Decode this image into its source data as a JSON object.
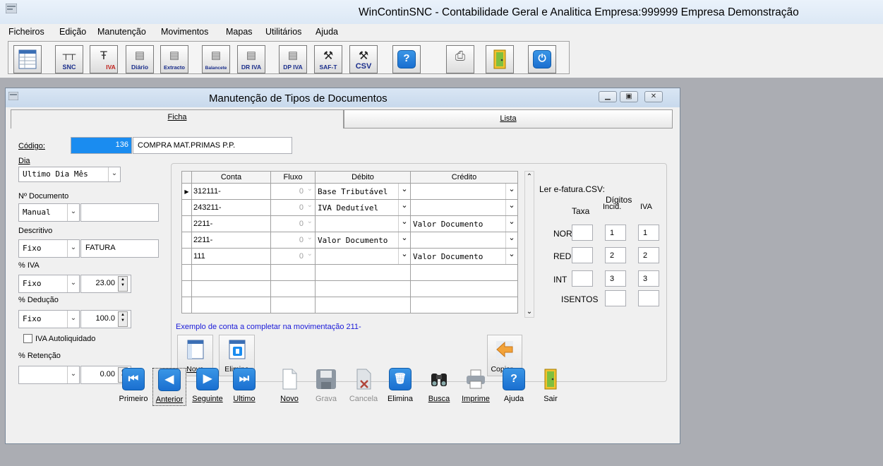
{
  "app": {
    "title": "WinContinSNC - Contabilidade Geral e Analitica Empresa:999999 Empresa Demonstração"
  },
  "menu": [
    "Ficheiros",
    "Edição",
    "Manutenção",
    "Movimentos",
    "Mapas",
    "Utilitários",
    "Ajuda"
  ],
  "toolbar": {
    "snc": "SNC",
    "iva": "IVA",
    "diario": "Diário",
    "extracto": "Extracto",
    "balancete": "Balancete",
    "dr_iva": "DR IVA",
    "dp_iva": "DP IVA",
    "saft": "SAF-T",
    "csv": "CSV",
    "help": "?",
    "power": "⏻"
  },
  "window": {
    "title": "Manutenção de Tipos de Documentos",
    "min": "▁",
    "max": "▣",
    "close": "✕"
  },
  "tabs": {
    "ficha": "Ficha",
    "lista": "Lista"
  },
  "form": {
    "codigo_label": "Código:",
    "codigo_value": "136",
    "codigo_desc": "COMPRA MAT.PRIMAS P.P.",
    "dia_label": "Dia",
    "dia_value": "Ultimo Dia Mês",
    "ndoc_label": "Nº Documento",
    "ndoc_mode": "Manual",
    "ndoc_value": "",
    "descritivo_label": "Descritivo",
    "descritivo_mode": "Fixo",
    "descritivo_value": "FATURA",
    "iva_label": "% IVA",
    "iva_mode": "Fixo",
    "iva_value": "23.00",
    "deducao_label": "% Dedução",
    "deducao_mode": "Fixo",
    "deducao_value": "100.0",
    "autoliq_label": "IVA Autoliquidado",
    "retencao_label": "% Retenção",
    "retencao_mode": "",
    "retencao_value": "0.00"
  },
  "grid": {
    "headers": [
      "Conta",
      "Fluxo",
      "Débito",
      "Crédito"
    ],
    "rows": [
      {
        "conta": "312111-",
        "fluxo": "0",
        "debito": "Base Tributável",
        "credito": ""
      },
      {
        "conta": "243211-",
        "fluxo": "0",
        "debito": "IVA Dedutível",
        "credito": ""
      },
      {
        "conta": "2211-",
        "fluxo": "0",
        "debito": "",
        "credito": "Valor Documento"
      },
      {
        "conta": "2211-",
        "fluxo": "0",
        "debito": "Valor Documento",
        "credito": ""
      },
      {
        "conta": "111",
        "fluxo": "0",
        "debito": "",
        "credito": "Valor Documento"
      }
    ],
    "note": "Exemplo de conta a completar na movimentação 211-",
    "nova_label": "Nova",
    "elimina_label": "Elimina",
    "copiar_label": "Copiar..."
  },
  "efatura": {
    "title": "Ler e-fatura.CSV:",
    "digitos": "Dígitos",
    "taxa": "Taxa",
    "incid": "Incid.",
    "iva": "IVA",
    "rows": [
      {
        "label": "NOR",
        "taxa": "",
        "incid": "1",
        "iva": "1"
      },
      {
        "label": "RED",
        "taxa": "",
        "incid": "2",
        "iva": "2"
      },
      {
        "label": "INT",
        "taxa": "",
        "incid": "3",
        "iva": "3"
      }
    ],
    "isentos": "ISENTOS"
  },
  "nav": {
    "primeiro": "Primeiro",
    "anterior": "Anterior",
    "seguinte": "Seguinte",
    "ultimo": "Ultimo",
    "novo": "Novo",
    "grava": "Grava",
    "cancela": "Cancela",
    "elimina": "Elimina",
    "busca": "Busca",
    "imprime": "Imprime",
    "ajuda": "Ajuda",
    "sair": "Sair"
  },
  "colors": {
    "codigo_bg": "#1a8cf0",
    "nav_blue": "#1a6fd0",
    "note_blue": "#1a1ad8"
  }
}
